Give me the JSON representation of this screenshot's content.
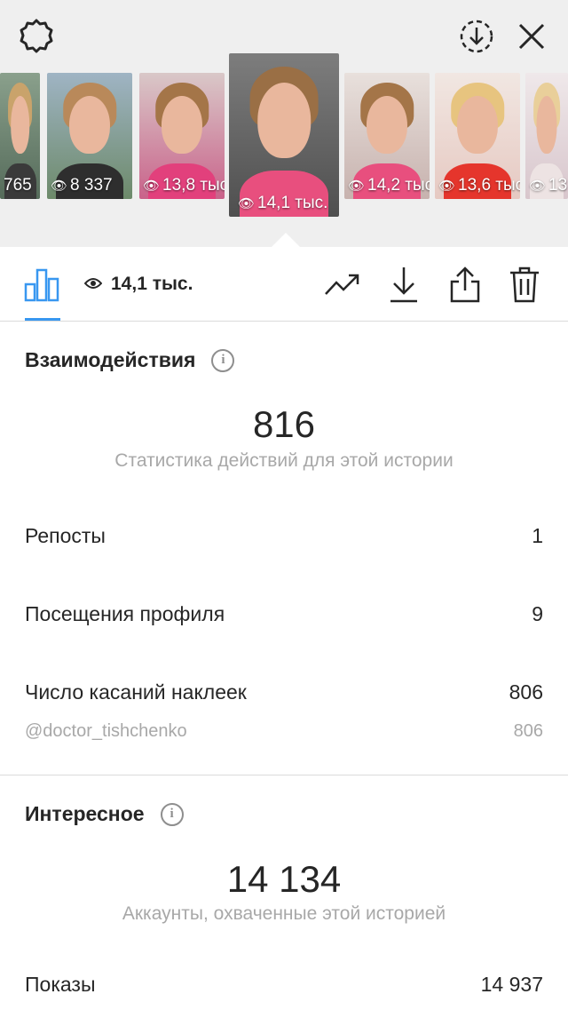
{
  "header": {
    "settings_icon": "gear-icon",
    "download_icon": "download-circle-icon",
    "close_icon": "close-icon"
  },
  "stories": [
    {
      "views": "765",
      "palette": "outdoor"
    },
    {
      "views": "8 337",
      "palette": "outdoor"
    },
    {
      "views": "13,8 тыс.",
      "palette": "pink"
    },
    {
      "views": "14,1 тыс.",
      "palette": "selected"
    },
    {
      "views": "14,2 тыс.",
      "palette": "pink"
    },
    {
      "views": "13,6 тыс.",
      "palette": "red"
    },
    {
      "views": "13",
      "palette": "light"
    }
  ],
  "toolbar": {
    "views_count": "14,1 тыс.",
    "icons": [
      "bar-chart-icon",
      "eye-icon",
      "trend-icon",
      "download-icon",
      "share-icon",
      "trash-icon"
    ]
  },
  "interactions": {
    "title": "Взаимодействия",
    "total": "816",
    "caption": "Статистика действий для этой истории",
    "rows": [
      {
        "label": "Репосты",
        "value": "1"
      },
      {
        "label": "Посещения профиля",
        "value": "9"
      },
      {
        "label": "Число касаний наклеек",
        "value": "806"
      }
    ],
    "sub_row": {
      "label": "@doctor_tishchenko",
      "value": "806"
    }
  },
  "discovery": {
    "title": "Интересное",
    "total": "14 134",
    "caption": "Аккаунты, охваченные этой историей",
    "rows": [
      {
        "label": "Показы",
        "value": "14 937"
      }
    ]
  },
  "colors": {
    "accent": "#3897f0",
    "text": "#262626",
    "muted": "#a8a8a8",
    "strip_bg": "#efefef"
  }
}
